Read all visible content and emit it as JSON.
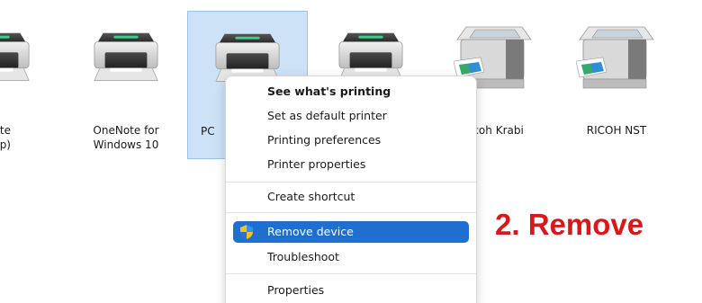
{
  "devices": [
    {
      "label_line1": "te",
      "label_line2": "p)",
      "icon": "printer-icon"
    },
    {
      "label_line1": "OneNote for",
      "label_line2": "Windows 10",
      "icon": "printer-icon"
    },
    {
      "label_line1": "PC",
      "label_line2": "",
      "icon": "printer-icon",
      "selected": true
    },
    {
      "label_line1": "",
      "label_line2": "",
      "icon": "printer-icon"
    },
    {
      "label_line1": "icoh Krabi",
      "label_line2": "",
      "icon": "multifunction-printer-icon"
    },
    {
      "label_line1": "RICOH NST",
      "label_line2": "",
      "icon": "multifunction-printer-icon"
    }
  ],
  "context_menu": {
    "items": [
      {
        "label": "See what's printing",
        "bold": true
      },
      {
        "label": "Set as default printer"
      },
      {
        "label": "Printing preferences"
      },
      {
        "label": "Printer properties"
      },
      {
        "label": "Create shortcut"
      },
      {
        "label": "Remove device",
        "icon": "shield-icon",
        "highlighted": true
      },
      {
        "label": "Troubleshoot"
      },
      {
        "label": "Properties"
      }
    ]
  },
  "annotation": {
    "text": "2. Remove"
  },
  "colors": {
    "selection_bg": "#cde2f7",
    "selection_border": "#99c3eb",
    "menu_highlight": "#1f6fd1",
    "annotation": "#d8191c"
  }
}
